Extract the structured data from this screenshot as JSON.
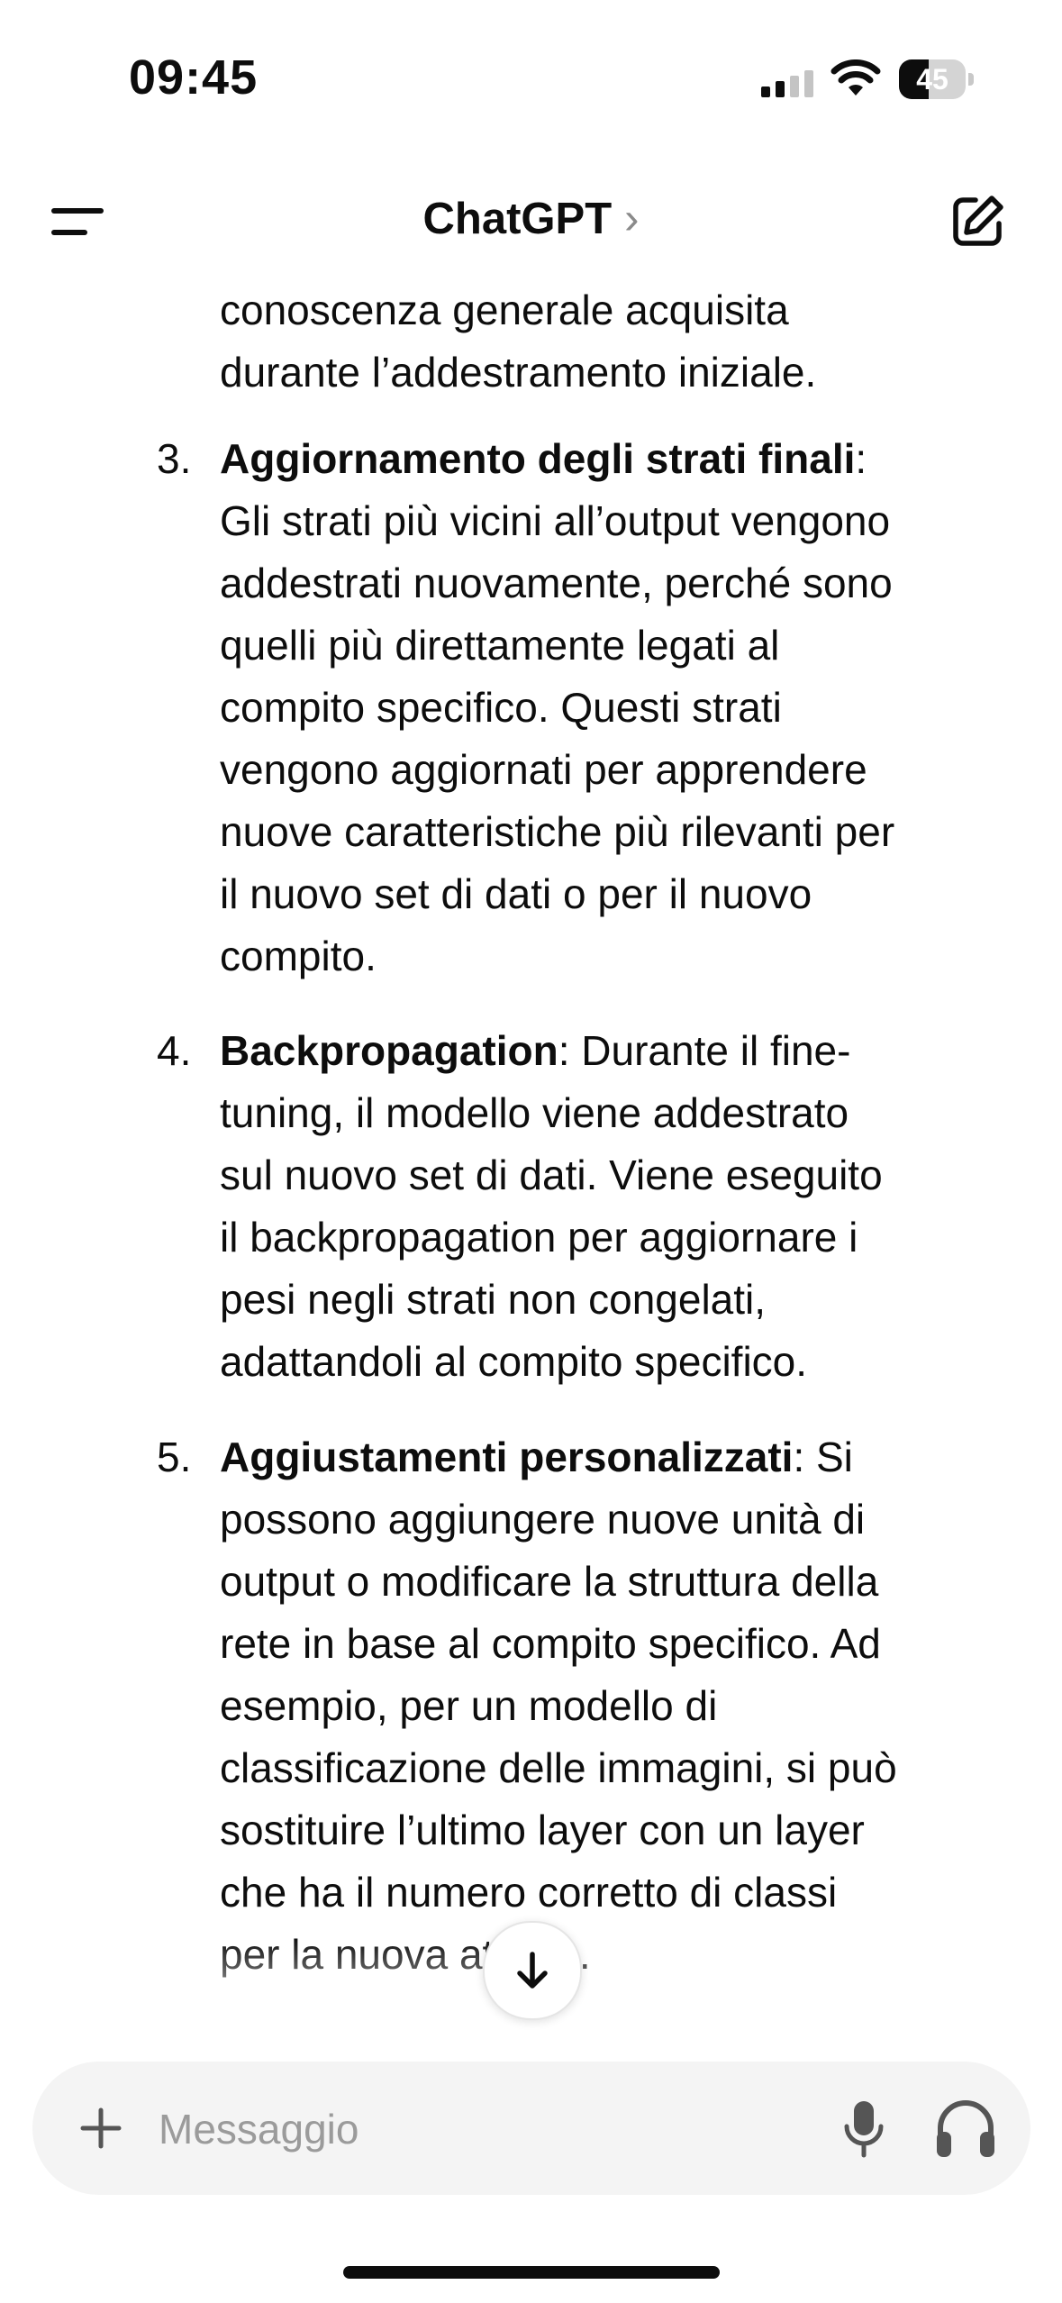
{
  "status_bar": {
    "time": "09:45",
    "battery": "45",
    "battery_level": 0.45
  },
  "header": {
    "title": "ChatGPT",
    "title_chevron": "›"
  },
  "content": {
    "continuation": [
      "conoscenza generale acquisita",
      "durante l’addestramento iniziale."
    ],
    "items": [
      {
        "number": "3.",
        "first_bold": "Aggiornamento degli strati finali",
        "first_rest": ":",
        "lines": [
          "Gli strati più vicini all’output vengono",
          "addestrati nuovamente, perché sono",
          "quelli più direttamente legati al",
          "compito specifico. Questi strati",
          "vengono aggiornati per apprendere",
          "nuove caratteristiche più rilevanti per",
          "il nuovo set di dati o per il nuovo",
          "compito."
        ]
      },
      {
        "number": "4.",
        "first_bold": "Backpropagation",
        "first_rest": ": Durante il fine-",
        "lines": [
          "tuning, il modello viene addestrato",
          "sul nuovo set di dati. Viene eseguito",
          "il backpropagation per aggiornare i",
          "pesi negli strati non congelati,",
          "adattandoli al compito specifico."
        ]
      },
      {
        "number": "5.",
        "first_bold": "Aggiustamenti personalizzati",
        "first_rest": ": Si",
        "lines": [
          "possono aggiungere nuove unità di",
          "output o modificare la struttura della",
          "rete in base al compito specifico. Ad",
          "esempio, per un modello di",
          "classificazione delle immagini, si può",
          "sostituire l’ultimo layer con un layer",
          "che ha il numero corretto di classi",
          "per la nuova attività."
        ]
      }
    ]
  },
  "composer": {
    "placeholder": "Messaggio"
  },
  "icons": {
    "menu": "menu-icon",
    "new_chat": "new-chat-icon",
    "scroll_down": "arrow-down-icon",
    "plus": "plus-icon",
    "mic": "mic-icon",
    "voice": "headphones-icon"
  }
}
